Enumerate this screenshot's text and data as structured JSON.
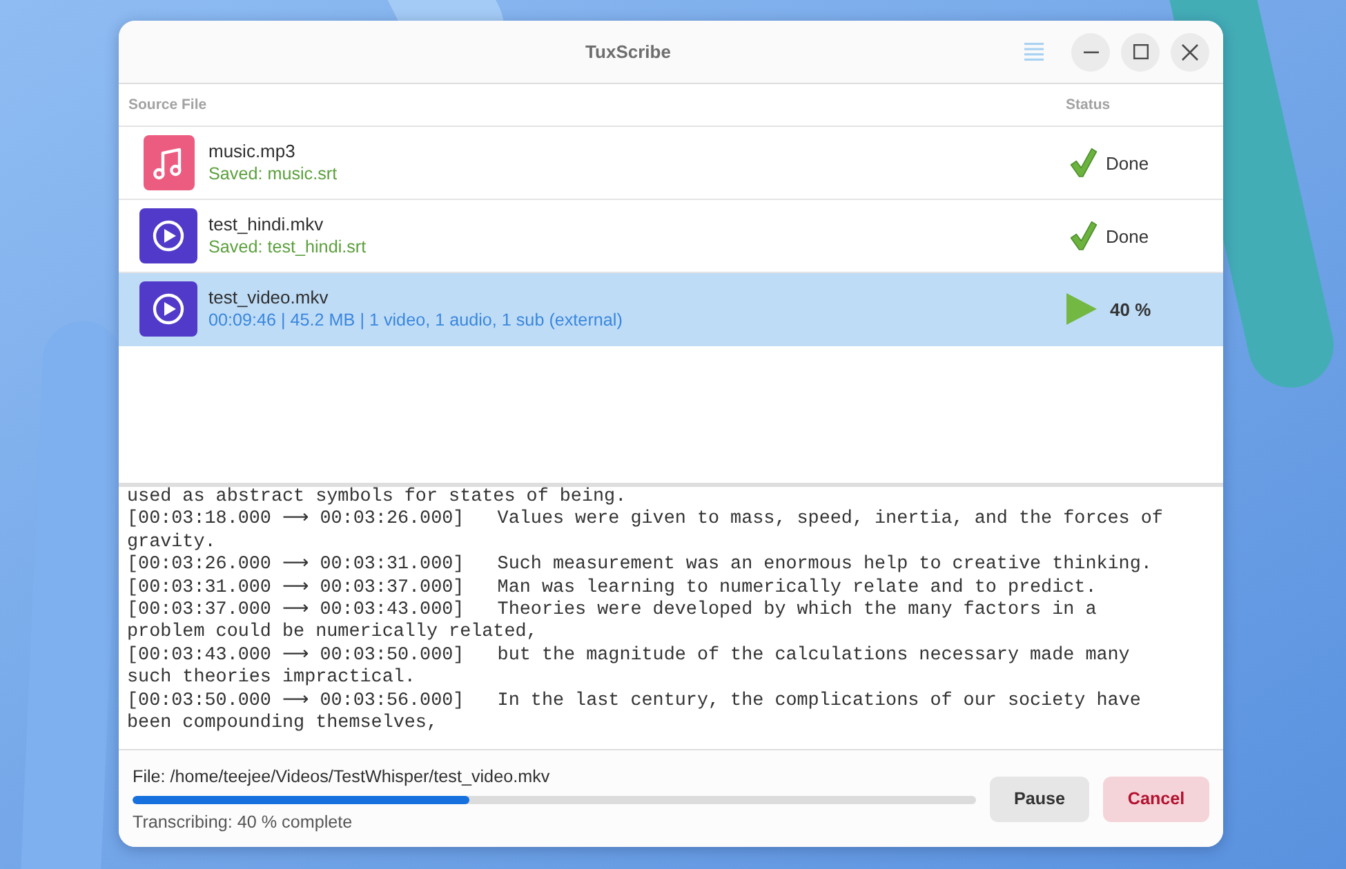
{
  "window": {
    "title": "TuxScribe"
  },
  "table": {
    "columns": [
      "Source File",
      "Status"
    ],
    "rows": [
      {
        "kind": "audio",
        "name": "music.mp3",
        "detail": "Saved: music.srt",
        "done": true,
        "status": "Done",
        "selected": false
      },
      {
        "kind": "video",
        "name": "test_hindi.mkv",
        "detail": "Saved: test_hindi.srt",
        "done": true,
        "status": "Done",
        "selected": false
      },
      {
        "kind": "video",
        "name": "test_video.mkv",
        "detail": "00:09:46 | 45.2 MB | 1 video, 1 audio, 1 sub (external)",
        "done": false,
        "status": "40 %",
        "selected": true
      }
    ]
  },
  "log": {
    "entries": [
      "used as abstract symbols for states of being.",
      "[00:03:18.000 ⟶ 00:03:26.000]   Values were given to mass, speed, inertia, and the forces of gravity.",
      "[00:03:26.000 ⟶ 00:03:31.000]   Such measurement was an enormous help to creative thinking.",
      "[00:03:31.000 ⟶ 00:03:37.000]   Man was learning to numerically relate and to predict.",
      "[00:03:37.000 ⟶ 00:03:43.000]   Theories were developed by which the many factors in a problem could be numerically related,",
      "[00:03:43.000 ⟶ 00:03:50.000]   but the magnitude of the calculations necessary made many such theories impractical.",
      "[00:03:50.000 ⟶ 00:03:56.000]   In the last century, the complications of our society have been compounding themselves,"
    ]
  },
  "footer": {
    "file": "File: /home/teejee/Videos/TestWhisper/test_video.mkv",
    "progress": {
      "level": 0.4
    },
    "status": "Transcribing: 40 % complete",
    "buttons": [
      {
        "label": "Pause",
        "kind": "neutral"
      },
      {
        "label": "Cancel",
        "kind": "destructive"
      }
    ]
  }
}
